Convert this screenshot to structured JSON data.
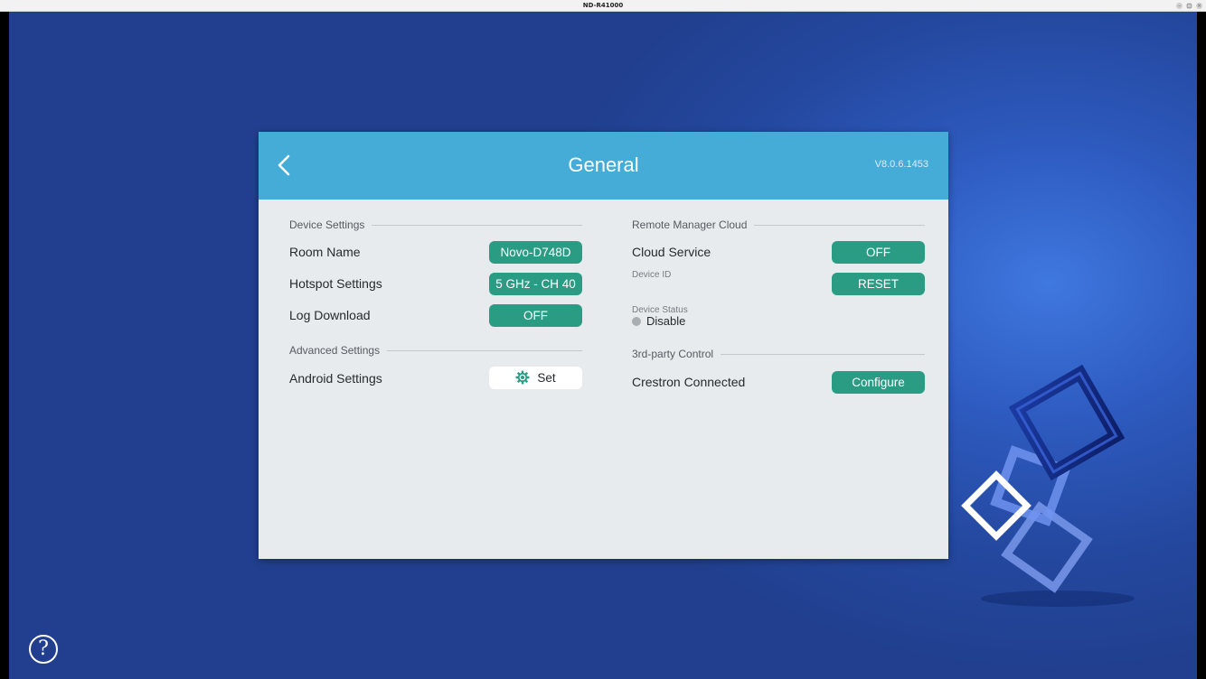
{
  "window": {
    "title": "ND-R41000"
  },
  "help": {
    "label": "?"
  },
  "panel": {
    "title": "General",
    "version": "V8.0.6.1453"
  },
  "device_settings": {
    "heading": "Device Settings",
    "room_name": {
      "label": "Room Name",
      "value": "Novo-D748D"
    },
    "hotspot": {
      "label": "Hotspot Settings",
      "value": "5 GHz - CH 40"
    },
    "log_download": {
      "label": "Log Download",
      "value": "OFF"
    }
  },
  "advanced_settings": {
    "heading": "Advanced Settings",
    "android": {
      "label": "Android Settings",
      "button": "Set"
    }
  },
  "remote_manager": {
    "heading": "Remote Manager Cloud",
    "cloud_service": {
      "label": "Cloud Service",
      "value": "OFF"
    },
    "device_id": {
      "label": "Device ID",
      "button": "RESET"
    },
    "device_status": {
      "label": "Device Status",
      "value": "Disable"
    }
  },
  "third_party": {
    "heading": "3rd-party Control",
    "crestron": {
      "label": "Crestron Connected",
      "button": "Configure"
    }
  },
  "colors": {
    "header_blue": "#45acd8",
    "button_green": "#2b9c84",
    "panel_bg": "#e8ebee",
    "desktop_blue": "#2e5bc0"
  }
}
